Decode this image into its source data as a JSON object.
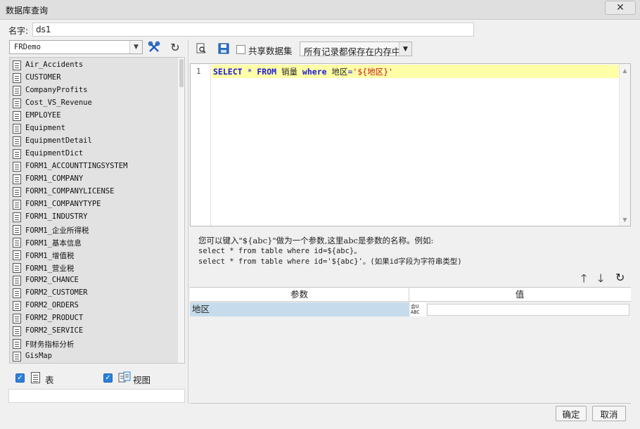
{
  "window": {
    "title": "数据库查询",
    "close_icon": "close-icon"
  },
  "name": {
    "label": "名字:",
    "value": "ds1"
  },
  "connection": {
    "selected": "FRDemo",
    "tables": [
      "Air_Accidents",
      "CUSTOMER",
      "CompanyProfits",
      "Cost_VS_Revenue",
      "EMPLOYEE",
      "Equipment",
      "EquipmentDetail",
      "EquipmentDict",
      "FORM1_ACCOUNTTINGSYSTEM",
      "FORM1_COMPANY",
      "FORM1_COMPANYLICENSE",
      "FORM1_COMPANYTYPE",
      "FORM1_INDUSTRY",
      "FORM1_企业所得税",
      "FORM1_基本信息",
      "FORM1_增值税",
      "FORM1_营业税",
      "FORM2_CHANCE",
      "FORM2_CUSTOMER",
      "FORM2_ORDERS",
      "FORM2_PRODUCT",
      "FORM2_SERVICE",
      "F财务指标分析",
      "GisMap"
    ],
    "filters": {
      "table_label": "表",
      "view_label": "视图"
    }
  },
  "toolbar": {
    "share_label": "共享数据集",
    "memory_mode": "所有记录都保存在内存中"
  },
  "sql": {
    "line_number": "1",
    "tokens": [
      {
        "t": "SELECT",
        "c": "kw"
      },
      {
        "t": " "
      },
      {
        "t": "*",
        "c": "op"
      },
      {
        "t": " "
      },
      {
        "t": "FROM",
        "c": "kw"
      },
      {
        "t": " 销量 "
      },
      {
        "t": "where",
        "c": "kw"
      },
      {
        "t": " 地区"
      },
      {
        "t": "=",
        "c": "op"
      },
      {
        "t": "'${地区}'",
        "c": "str"
      }
    ]
  },
  "help": {
    "line1": "您可以键入\"${abc}\"做为一个参数,这里abc是参数的名称。例如:",
    "line2": "select * from table where id=${abc}。",
    "line3": "select * from table where id='${abc}'。(如果id字段为字符串类型)"
  },
  "params": {
    "col_name": "参数",
    "col_value": "值",
    "rows": [
      {
        "name": "地区",
        "value": ""
      }
    ],
    "type_icon_text": "会U ABC"
  },
  "footer": {
    "ok_label": "确定",
    "cancel_label": "取消"
  }
}
